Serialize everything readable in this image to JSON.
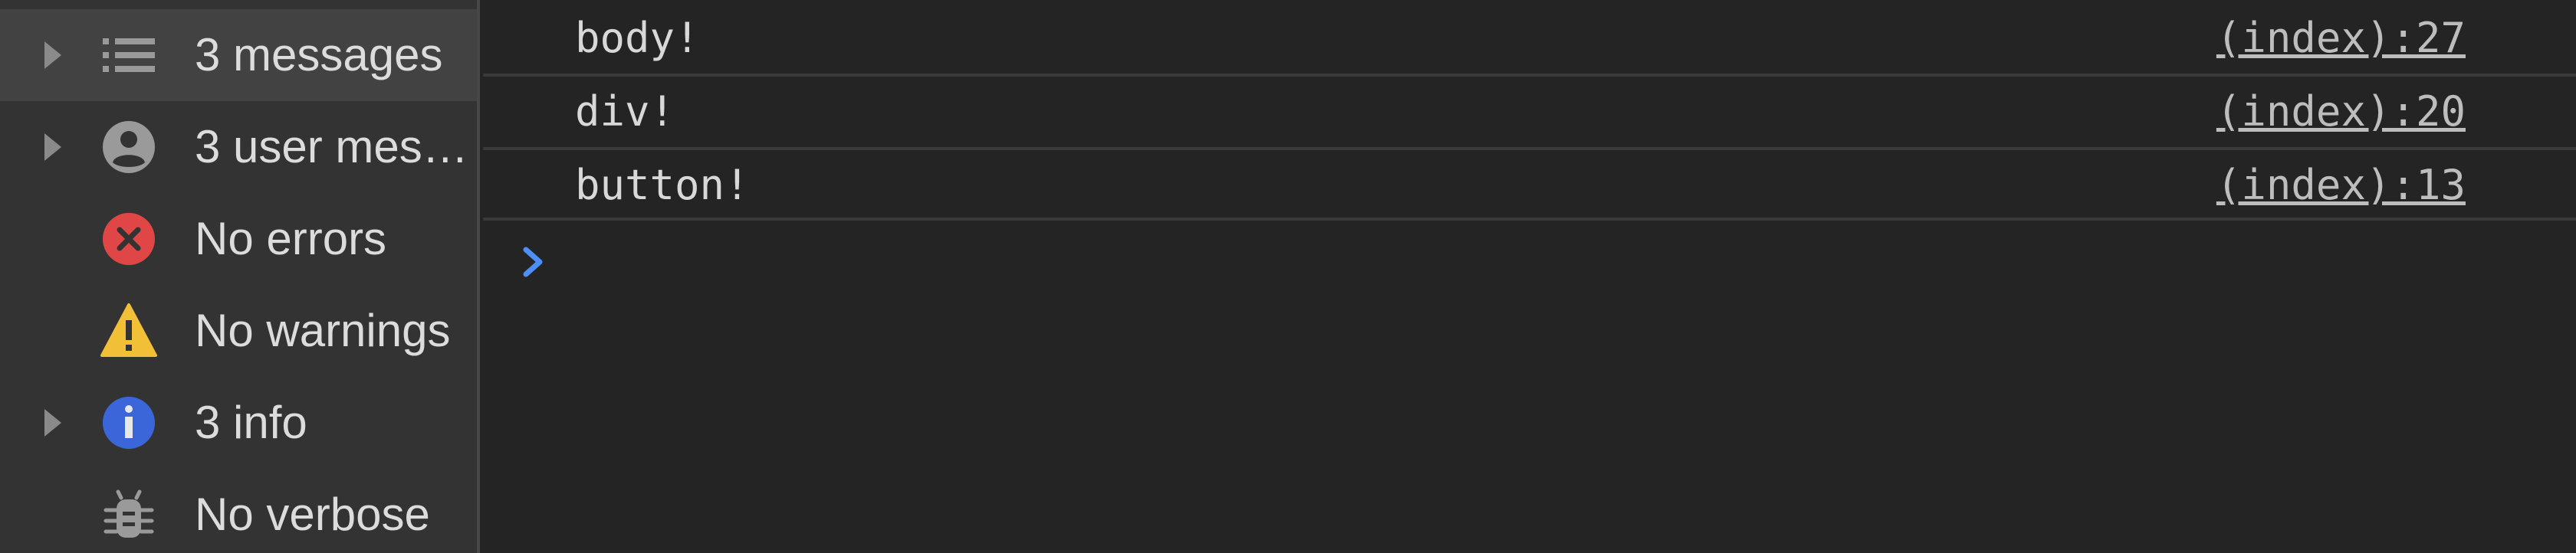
{
  "sidebar": {
    "items": [
      {
        "label": "3 messages",
        "icon": "list-icon",
        "expandable": true,
        "selected": true
      },
      {
        "label": "3 user mes…",
        "icon": "user-icon",
        "expandable": true,
        "selected": false
      },
      {
        "label": "No errors",
        "icon": "error-icon",
        "expandable": false,
        "selected": false
      },
      {
        "label": "No warnings",
        "icon": "warning-icon",
        "expandable": false,
        "selected": false
      },
      {
        "label": "3 info",
        "icon": "info-icon",
        "expandable": true,
        "selected": false
      },
      {
        "label": "No verbose",
        "icon": "bug-icon",
        "expandable": false,
        "selected": false
      }
    ]
  },
  "console": {
    "messages": [
      {
        "text": "body!",
        "source": "(index):27"
      },
      {
        "text": "div!",
        "source": "(index):20"
      },
      {
        "text": "button!",
        "source": "(index):13"
      }
    ],
    "prompt": {
      "value": "",
      "placeholder": ""
    }
  },
  "colors": {
    "background": "#242424",
    "sidebar": "#333333",
    "selected": "#424242",
    "error": "#e04646",
    "warning": "#f2c037",
    "info": "#3b66d9",
    "prompt_caret": "#4d8ef7"
  }
}
